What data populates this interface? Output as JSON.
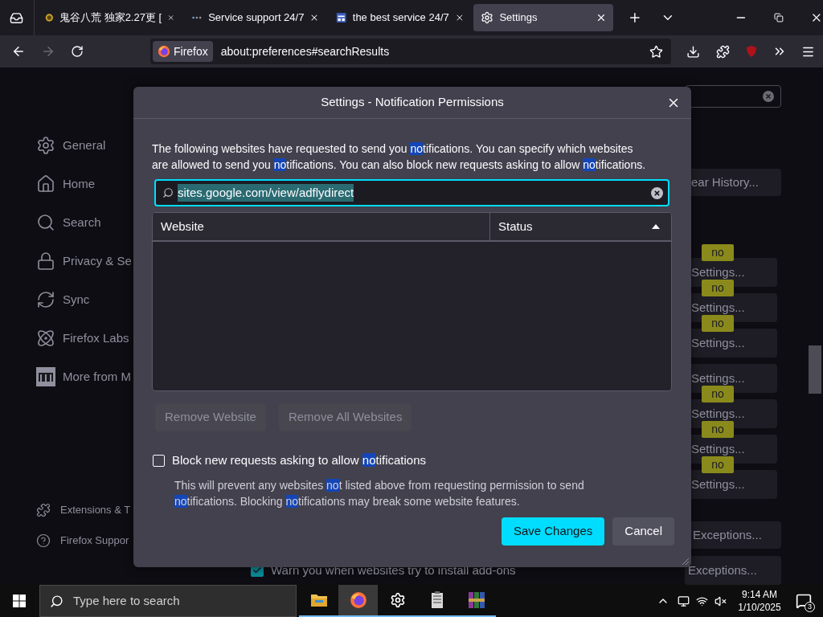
{
  "tabs": [
    {
      "title": "鬼谷八荒 独家2.27更 [",
      "selected": false
    },
    {
      "title": "Service support 24/7",
      "selected": false
    },
    {
      "title": "the best service 24/7",
      "selected": false
    },
    {
      "title": "Settings",
      "selected": true
    }
  ],
  "toolbar": {
    "forward_disabled": true,
    "identity": "Firefox",
    "url": "about:preferences#searchResults"
  },
  "sidebar": {
    "items": [
      "General",
      "Home",
      "Search",
      "Privacy & Se",
      "Sync",
      "Firefox Labs",
      "More from M"
    ],
    "footer": [
      "Extensions & T",
      "Firefox Suppor"
    ]
  },
  "page": {
    "history_button": "ear History...",
    "settings_buttons": [
      {
        "label": "Settings...",
        "badge": "no"
      },
      {
        "label": "Settings...",
        "badge": "no"
      },
      {
        "label": "Settings...",
        "badge": "no"
      },
      {
        "label": "Settings..."
      },
      {
        "label": "Settings...",
        "badge": "no"
      },
      {
        "label": "Settings...",
        "badge": "no"
      },
      {
        "label": "Settings...",
        "badge": "no"
      }
    ],
    "exception_buttons": [
      "Exceptions...",
      "Exceptions..."
    ],
    "addons_checkbox": {
      "label": "Warn you when websites try to install add-ons",
      "checked": true
    }
  },
  "dialog": {
    "title": "Settings - Notification Permissions",
    "intro": [
      {
        "text": "The following websites have requested to send you ",
        "match": false
      },
      {
        "text": "no",
        "match": true
      },
      {
        "text": "tifications. You can specify which websites are allowed to send you ",
        "match": false
      },
      {
        "text": "no",
        "match": true
      },
      {
        "text": "tifications. You can also block new requests asking to allow ",
        "match": false
      },
      {
        "text": "no",
        "match": true
      },
      {
        "text": "tifications.",
        "match": false
      }
    ],
    "search": {
      "value": "sites.google.com/view/adflydirect",
      "text_selected": true
    },
    "columns": [
      {
        "label": "Website",
        "sorted": false
      },
      {
        "label": "Status",
        "sorted": true
      }
    ],
    "actions": [
      {
        "label": "Remove Website",
        "disabled": true
      },
      {
        "label": "Remove All Websites",
        "disabled": true
      }
    ],
    "block_checkbox": {
      "checked": false,
      "label": [
        {
          "text": "Block new requests asking to allow ",
          "match": false
        },
        {
          "text": "no",
          "match": true
        },
        {
          "text": "tifications",
          "match": false
        }
      ]
    },
    "block_note": [
      {
        "text": "This will prevent any websites ",
        "match": false
      },
      {
        "text": "no",
        "match": true
      },
      {
        "text": "t listed above from requesting permission to send ",
        "match": false
      },
      {
        "text": "no",
        "match": true
      },
      {
        "text": "tifications. Blocking ",
        "match": false
      },
      {
        "text": "no",
        "match": true
      },
      {
        "text": "tifications may break some website features.",
        "match": false
      }
    ],
    "buttons": [
      {
        "label": "Save Changes",
        "kind": "primary"
      },
      {
        "label": "Cancel",
        "kind": "secondary"
      }
    ]
  },
  "taskbar": {
    "search_placeholder": "Type here to search",
    "apps": [
      {
        "selected": false
      },
      {
        "selected": true
      },
      {
        "selected": false
      },
      {
        "selected": false
      },
      {
        "selected": false
      }
    ],
    "time": "9:14 AM",
    "date": "1/10/2025",
    "notifications": "3"
  }
}
